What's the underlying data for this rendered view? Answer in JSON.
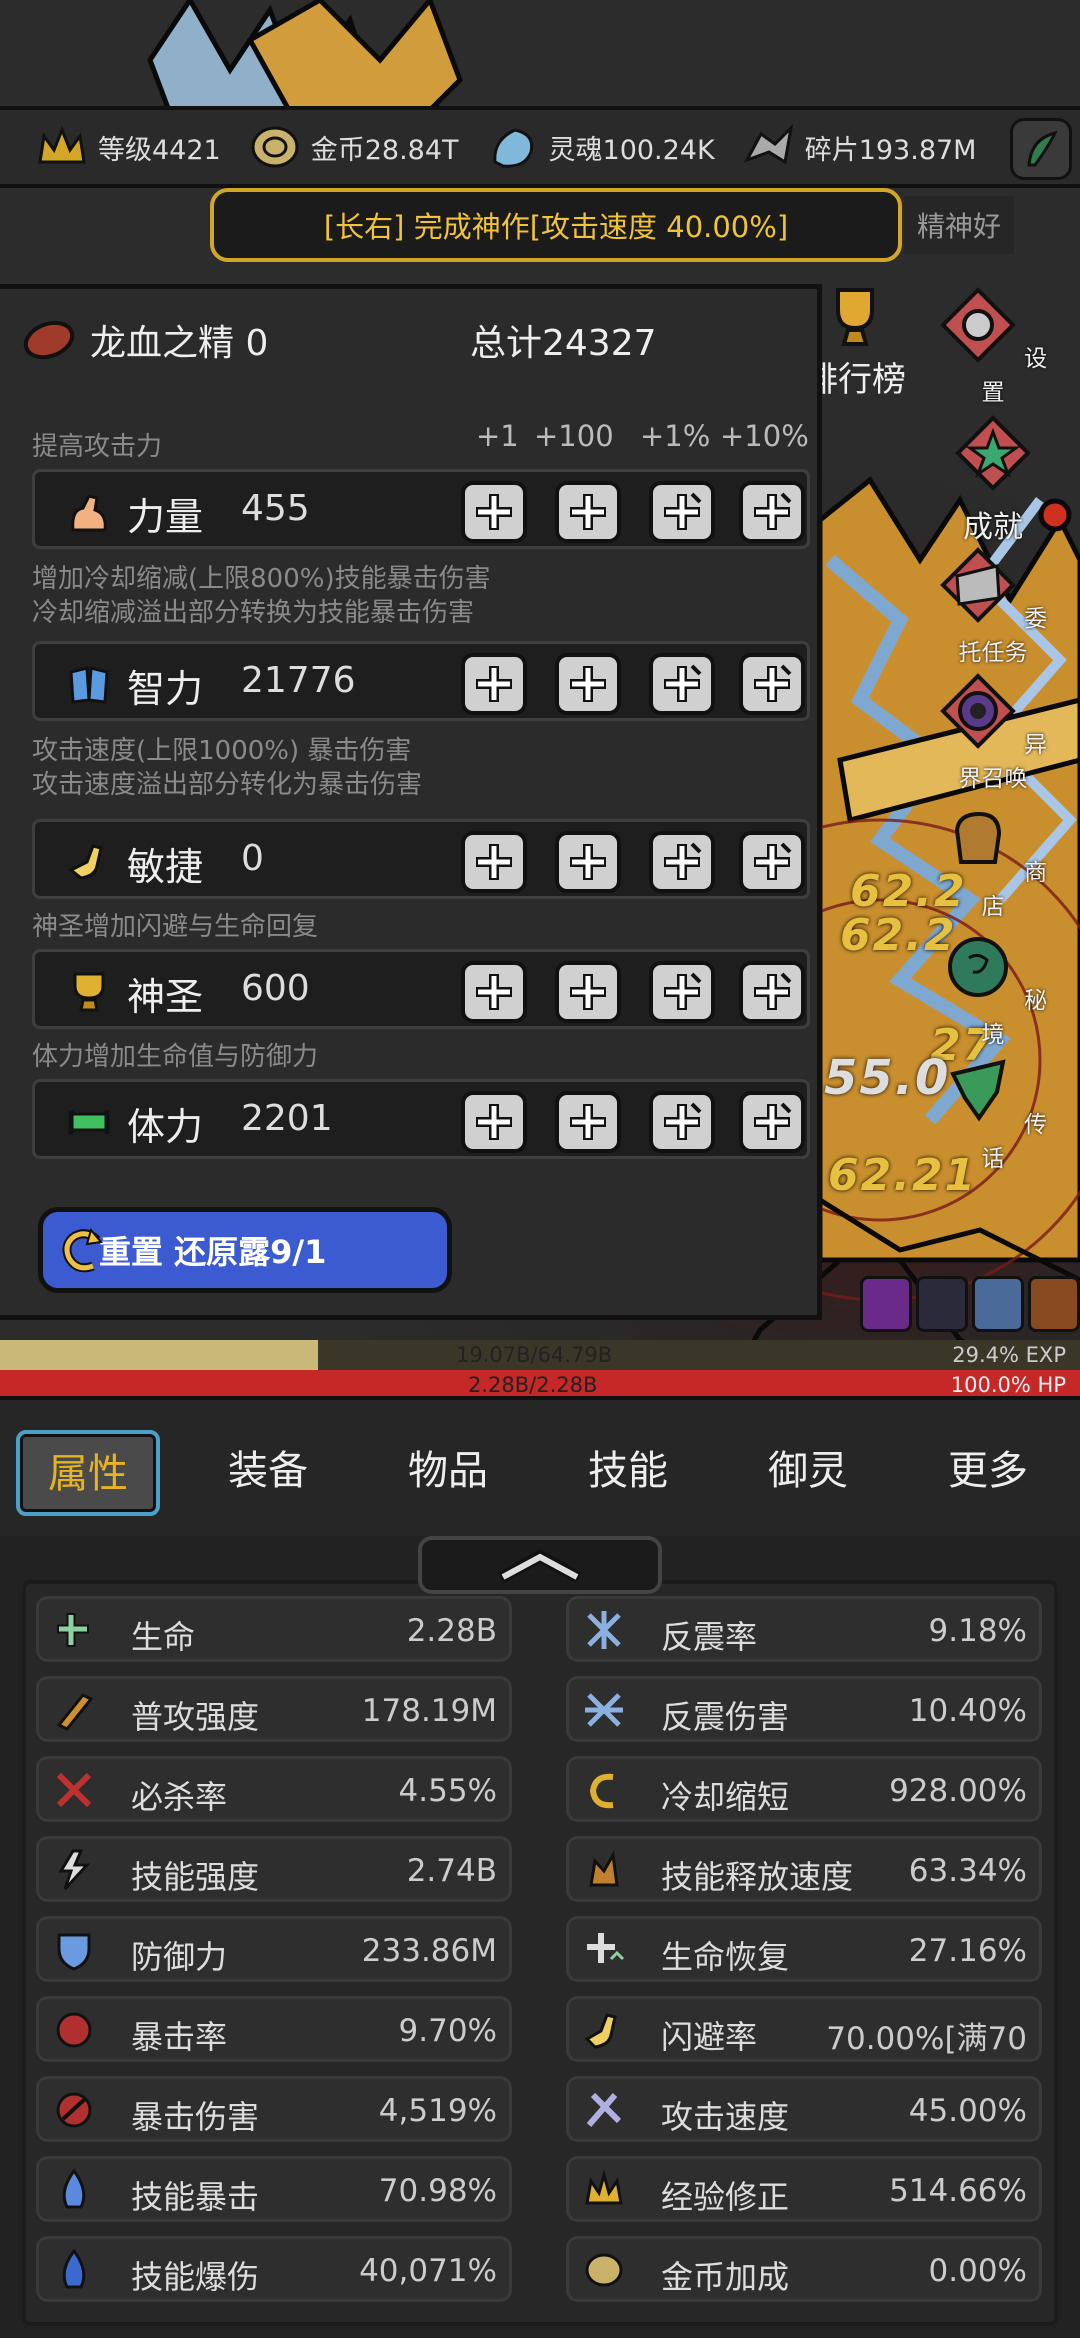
{
  "currencies": [
    {
      "icon": "crown-icon",
      "label": "等级4421"
    },
    {
      "icon": "coin-icon",
      "label": "金币28.84T"
    },
    {
      "icon": "soul-icon",
      "label": "灵魂100.24K"
    },
    {
      "icon": "shard-icon",
      "label": "碎片193.87M"
    }
  ],
  "banner": "[长右] 完成神作[攻击速度 40.00%]",
  "mood": "精神好",
  "rank_label": "排行榜",
  "side_menu": [
    {
      "icon": "settings-icon",
      "label": "设置"
    },
    {
      "icon": "achievement-icon",
      "label": "成就"
    },
    {
      "icon": "commission-icon",
      "label": "委托任务"
    },
    {
      "icon": "summon-icon",
      "label": "异界召唤"
    },
    {
      "icon": "shop-icon",
      "label": "商店"
    },
    {
      "icon": "secret-realm-icon",
      "label": "秘境"
    },
    {
      "icon": "legend-icon",
      "label": "传话"
    }
  ],
  "damage_numbers": [
    "62.2",
    "62.2",
    "27",
    "55.0",
    "62.21"
  ],
  "panel": {
    "essence_label": "龙血之精 0",
    "total_label": "总计24327",
    "columns": [
      "+1",
      "+100",
      "+1%",
      "+10%"
    ],
    "attributes": [
      {
        "desc": [
          "提高攻击力"
        ],
        "icon": "strength-icon",
        "name": "力量",
        "value": "455"
      },
      {
        "desc": [
          "增加冷却缩减(上限800%)技能暴击伤害",
          "冷却缩减溢出部分转换为技能暴击伤害"
        ],
        "icon": "intelligence-icon",
        "name": "智力",
        "value": "21776"
      },
      {
        "desc": [
          "攻击速度(上限1000%) 暴击伤害",
          "攻击速度溢出部分转化为暴击伤害"
        ],
        "icon": "agility-icon",
        "name": "敏捷",
        "value": "0"
      },
      {
        "desc": [
          "神圣增加闪避与生命回复"
        ],
        "icon": "holy-icon",
        "name": "神圣",
        "value": "600"
      },
      {
        "desc": [
          "体力增加生命值与防御力"
        ],
        "icon": "stamina-icon",
        "name": "体力",
        "value": "2201"
      }
    ],
    "reset_label": "重置 还原露9/1"
  },
  "exp_bar": {
    "text": "19.07B/64.79B",
    "percent_text": "29.4% EXP",
    "fraction": 0.294
  },
  "hp_bar": {
    "text": "2.28B/2.28B",
    "percent_text": "100.0%  HP",
    "fraction": 1.0
  },
  "tabs": [
    "属性",
    "装备",
    "物品",
    "技能",
    "御灵",
    "更多"
  ],
  "stats_left": [
    {
      "icon": "life-icon",
      "name": "生命",
      "value": "2.28B"
    },
    {
      "icon": "attack-power-icon",
      "name": "普攻强度",
      "value": "178.19M"
    },
    {
      "icon": "kill-rate-icon",
      "name": "必杀率",
      "value": "4.55%"
    },
    {
      "icon": "skill-power-icon",
      "name": "技能强度",
      "value": "2.74B"
    },
    {
      "icon": "defense-icon",
      "name": "防御力",
      "value": "233.86M"
    },
    {
      "icon": "crit-rate-icon",
      "name": "暴击率",
      "value": "9.70%"
    },
    {
      "icon": "crit-damage-icon",
      "name": "暴击伤害",
      "value": "4,519%"
    },
    {
      "icon": "skill-crit-icon",
      "name": "技能暴击",
      "value": "70.98%"
    },
    {
      "icon": "skill-burst-icon",
      "name": "技能爆伤",
      "value": "40,071%"
    }
  ],
  "stats_right": [
    {
      "icon": "reflect-rate-icon",
      "name": "反震率",
      "value": "9.18%"
    },
    {
      "icon": "reflect-damage-icon",
      "name": "反震伤害",
      "value": "10.40%"
    },
    {
      "icon": "cooldown-icon",
      "name": "冷却缩短",
      "value": "928.00%"
    },
    {
      "icon": "cast-speed-icon",
      "name": "技能释放速度",
      "value": "63.34%"
    },
    {
      "icon": "regen-icon",
      "name": "生命恢复",
      "value": "27.16%"
    },
    {
      "icon": "dodge-icon",
      "name": "闪避率",
      "value": "70.00%[满70"
    },
    {
      "icon": "attack-speed-icon",
      "name": "攻击速度",
      "value": "45.00%"
    },
    {
      "icon": "exp-bonus-icon",
      "name": "经验修正",
      "value": "514.66%"
    },
    {
      "icon": "gold-bonus-icon",
      "name": "金币加成",
      "value": "0.00%"
    }
  ],
  "colors": {
    "accent_gold": "#e6b422",
    "banner_border": "#d4a628",
    "reset_blue": "#3d5bd0",
    "hp_red": "#c62828",
    "exp_olive": "#c9b878",
    "tab_active_border": "#4ba0c8"
  }
}
